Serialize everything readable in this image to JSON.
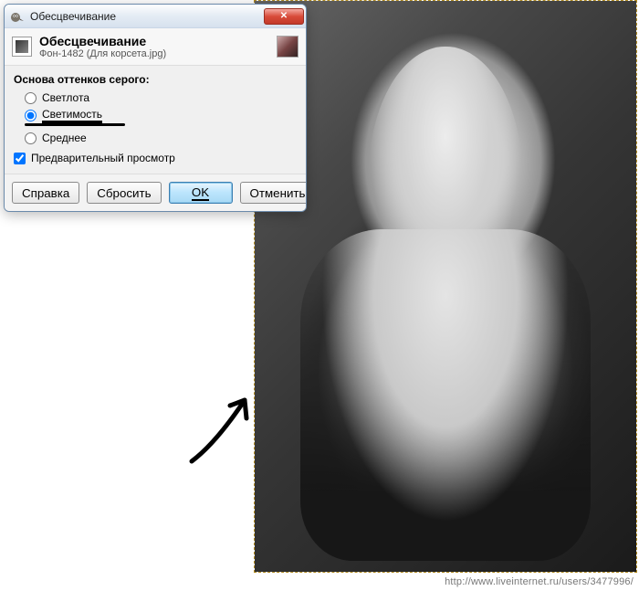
{
  "dialog": {
    "window_title": "Обесцвечивание",
    "header_title": "Обесцвечивание",
    "header_sub": "Фон-1482 (Для корсета.jpg)",
    "group_label": "Основа оттенков серого:",
    "options": {
      "lightness": "Светлота",
      "luminosity": "Светимость",
      "average": "Среднее"
    },
    "selected_option": "luminosity",
    "preview_label": "Предварительный просмотр",
    "preview_checked": true,
    "buttons": {
      "help": "Справка",
      "reset": "Сбросить",
      "ok": "OK",
      "cancel": "Отменить"
    }
  },
  "icons": {
    "app": "gimp",
    "desaturate": "desaturate",
    "close": "✕"
  },
  "watermark": "http://www.liveinternet.ru/users/3477996/"
}
